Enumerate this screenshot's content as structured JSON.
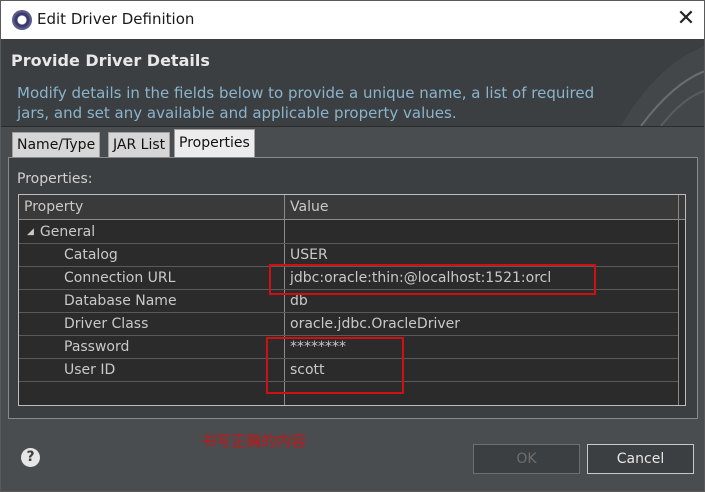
{
  "window": {
    "title": "Edit Driver Definition",
    "close_icon": "close-icon"
  },
  "banner": {
    "title": "Provide Driver Details",
    "description": "Modify details in the fields below to provide a unique name, a list of required jars, and set any available and applicable property values."
  },
  "tabs": [
    {
      "label": "Name/Type",
      "active": false
    },
    {
      "label": "JAR List",
      "active": false
    },
    {
      "label": "Properties",
      "active": true
    }
  ],
  "properties": {
    "label": "Properties:",
    "columns": {
      "property": "Property",
      "value": "Value"
    },
    "group": "General",
    "rows": [
      {
        "property": "Catalog",
        "value": "USER"
      },
      {
        "property": "Connection URL",
        "value": "jdbc:oracle:thin:@localhost:1521:orcl"
      },
      {
        "property": "Database Name",
        "value": "db"
      },
      {
        "property": "Driver Class",
        "value": "oracle.jdbc.OracleDriver"
      },
      {
        "property": "Password",
        "value": "********"
      },
      {
        "property": "User ID",
        "value": "scott"
      }
    ]
  },
  "annotation": {
    "note": "书写正确的内容",
    "color": "#c01818"
  },
  "buttons": {
    "ok": "OK",
    "cancel": "Cancel"
  },
  "colors": {
    "background": "#3c3f41",
    "accent_text": "#8ab4cc"
  }
}
